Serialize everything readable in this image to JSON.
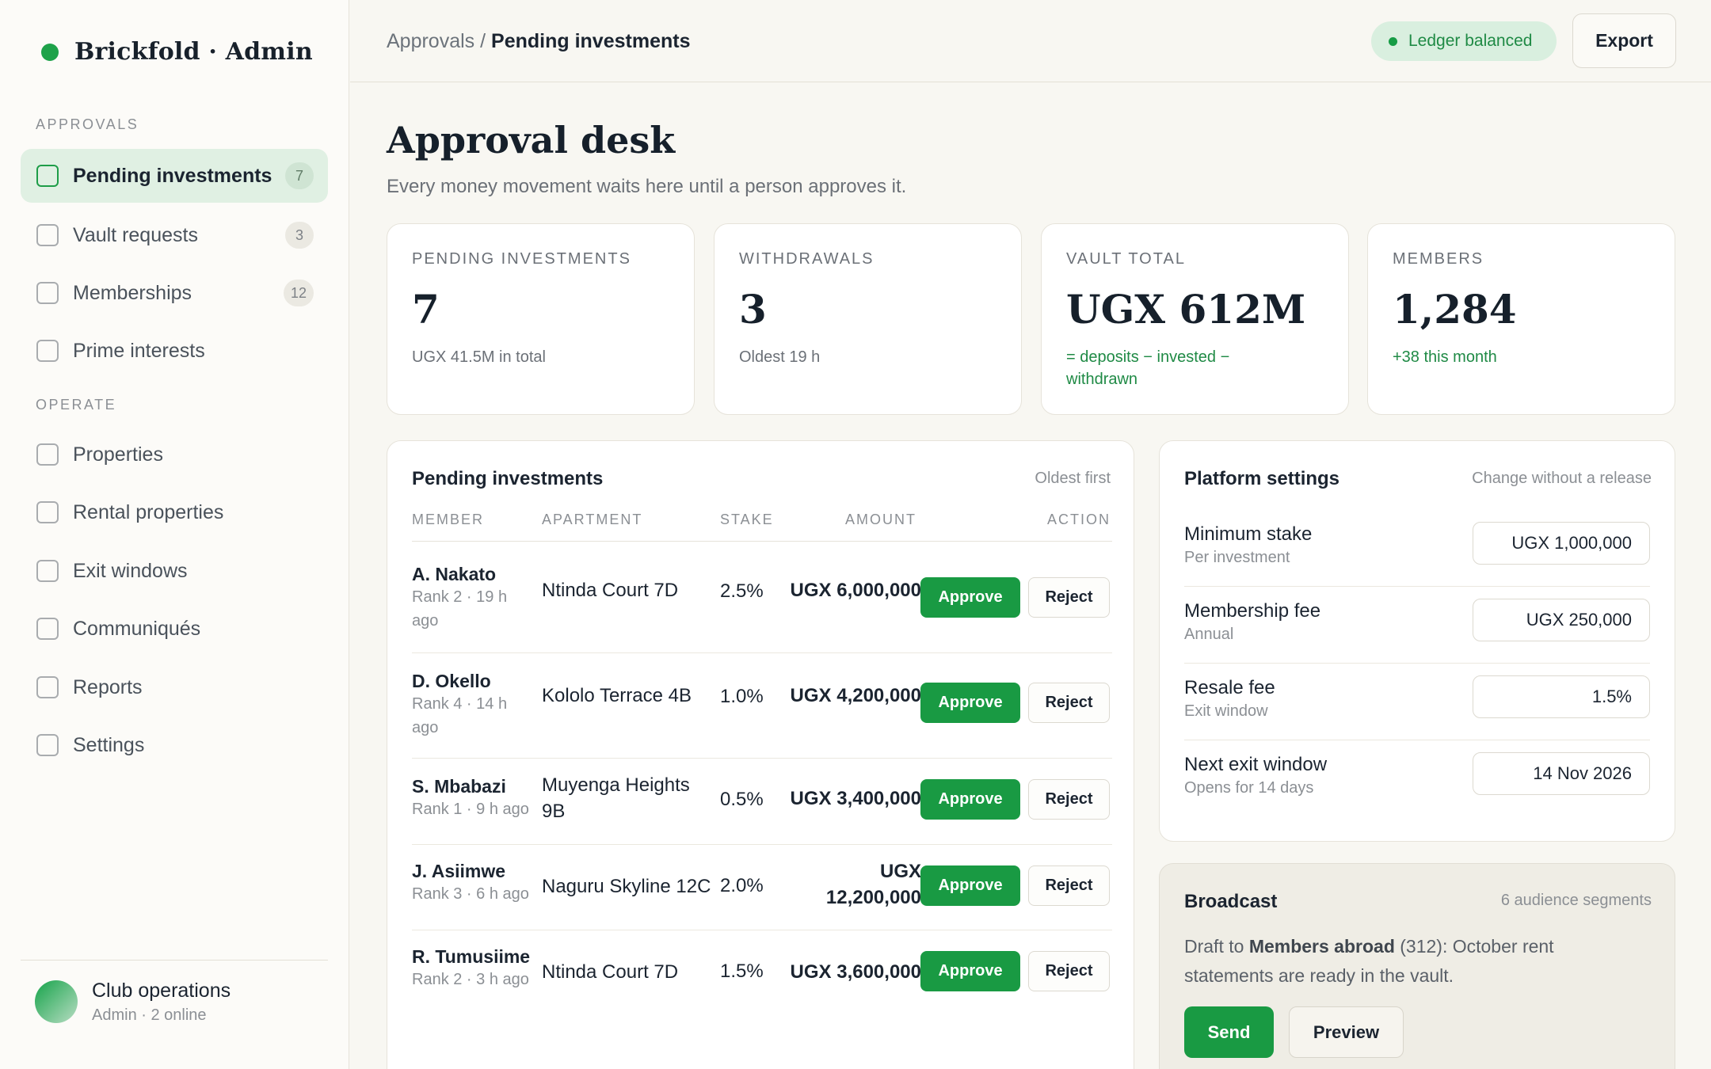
{
  "brand": {
    "name": "Brickfold · Admin"
  },
  "sidebar": {
    "section_approvals": "APPROVALS",
    "section_operate": "OPERATE",
    "items": [
      {
        "label": "Pending investments",
        "badge": "7"
      },
      {
        "label": "Vault requests",
        "badge": "3"
      },
      {
        "label": "Memberships",
        "badge": "12"
      },
      {
        "label": "Prime interests"
      },
      {
        "label": "Properties"
      },
      {
        "label": "Rental properties"
      },
      {
        "label": "Exit windows"
      },
      {
        "label": "Communiqués"
      },
      {
        "label": "Reports"
      },
      {
        "label": "Settings"
      }
    ],
    "user": {
      "name": "Club operations",
      "sub": "Admin · 2 online"
    }
  },
  "topbar": {
    "crumb_parent": "Approvals",
    "crumb_sep": "/",
    "crumb_current": "Pending investments",
    "status": "Ledger balanced",
    "export_label": "Export"
  },
  "header": {
    "title": "Approval desk",
    "subtitle": "Every money movement waits here until a person approves it."
  },
  "stats": [
    {
      "label": "PENDING INVESTMENTS",
      "value": "7",
      "note": "UGX 41.5M in total"
    },
    {
      "label": "WITHDRAWALS",
      "value": "3",
      "note": "Oldest 19 h"
    },
    {
      "label": "VAULT TOTAL",
      "value": "UGX 612M",
      "note": "= deposits − invested − withdrawn"
    },
    {
      "label": "MEMBERS",
      "value": "1,284",
      "note": "+38 this month"
    }
  ],
  "pending": {
    "title": "Pending investments",
    "sort": "Oldest first",
    "columns": [
      "MEMBER",
      "APARTMENT",
      "STAKE",
      "AMOUNT",
      "ACTION"
    ],
    "approve_label": "Approve",
    "reject_label": "Reject",
    "rows": [
      {
        "name": "A. Nakato",
        "meta": "Rank 2 · 19 h ago",
        "apartment": "Ntinda Court 7D",
        "stake": "2.5%",
        "amount": "UGX 6,000,000"
      },
      {
        "name": "D. Okello",
        "meta": "Rank 4 · 14 h ago",
        "apartment": "Kololo Terrace 4B",
        "stake": "1.0%",
        "amount": "UGX 4,200,000"
      },
      {
        "name": "S. Mbabazi",
        "meta": "Rank 1 · 9 h ago",
        "apartment": "Muyenga Heights 9B",
        "stake": "0.5%",
        "amount": "UGX 3,400,000"
      },
      {
        "name": "J. Asiimwe",
        "meta": "Rank 3 · 6 h ago",
        "apartment": "Naguru Skyline 12C",
        "stake": "2.0%",
        "amount": "UGX 12,200,000"
      },
      {
        "name": "R. Tumusiime",
        "meta": "Rank 2 · 3 h ago",
        "apartment": "Ntinda Court 7D",
        "stake": "1.5%",
        "amount": "UGX 3,600,000"
      }
    ]
  },
  "settings": {
    "title": "Platform settings",
    "meta": "Change without a release",
    "items": [
      {
        "label": "Minimum stake",
        "sub": "Per investment",
        "value": "UGX 1,000,000"
      },
      {
        "label": "Membership fee",
        "sub": "Annual",
        "value": "UGX 250,000"
      },
      {
        "label": "Resale fee",
        "sub": "Exit window",
        "value": "1.5%"
      },
      {
        "label": "Next exit window",
        "sub": "Opens for 14 days",
        "value": "14 Nov 2026"
      }
    ]
  },
  "broadcast": {
    "title": "Broadcast",
    "meta": "6 audience segments",
    "text_prefix": "Draft to ",
    "audience": "Members abroad",
    "text_suffix": " (312): October rent statements are ready in the vault.",
    "send_label": "Send",
    "preview_label": "Preview"
  },
  "colors": {
    "accent": "#199a43",
    "accent_soft": "#e0f0e3",
    "background": "#f8f7f2"
  },
  "icons": {
    "nav_item": "checkbox-icon",
    "status": "status-dot-icon"
  }
}
